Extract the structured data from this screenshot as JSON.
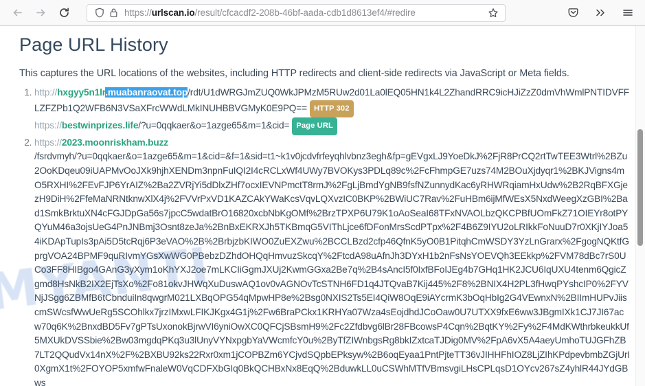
{
  "browser": {
    "back_label": "Back",
    "forward_label": "Forward",
    "reload_label": "Reload",
    "url_scheme": "https://",
    "url_host": "urlscan.io",
    "url_path": "/result/cfcacdf2-208b-46bf-aada-cdb1d8613ef4/#redire",
    "url_full": "https://urlscan.io/result/cfcacdf2-208b-46bf-aada-cdb1d8613ef4/#redire",
    "bookmark_label": "Bookmark this page",
    "pocket_label": "Save to Pocket",
    "overflow_label": "More tools",
    "menu_label": "Open application menu"
  },
  "page": {
    "title": "Page URL History",
    "intro": "This captures the URL locations of the websites, including HTTP redirects and client-side redirects via JavaScript or Meta fields.",
    "watermark": "MYANTI"
  },
  "items": [
    {
      "index": "1",
      "scheme": "http://",
      "host_plain": "hxgyy5n1lr",
      "host_selected": ".muabanraovat.top",
      "path": "/rdt/U1dWRGJmZUQ0WkJPMzM5RUw2d01La0lEQ05HN1k4L2ZhandRRC9icHJiZzZ0dmVhWmlPNTIDVFFLZFZPb1Q2WFB6N3VSaXFrcWWdLMkINUHBBVGMyK0E9PQ==",
      "badge": "HTTP 302",
      "badge_type": "http",
      "sub": {
        "scheme": "https://",
        "host": "bestwinprizes.life",
        "path": "/?u=0qqkaer&o=1azge65&m=1&cid=",
        "badge": "Page URL",
        "badge_type": "pageurl"
      }
    },
    {
      "index": "2",
      "scheme": "https://",
      "host_plain": "2023.moonriskham.buzz",
      "host_selected": "",
      "path": "/fsrdvmyh/?u=0qqkaer&o=1azge65&m=1&cid=&f=1&sid=t1~k1v0jcdvfrfeyqhlvbnz3egh&fp=gEVgxLJ9YoeDkJ%2FjR8PrCQ2rtTwTEE3Wtrl%2BZu2OoKDqeu09iUAPMvOoJXk9hjhXENDm3npnFuIQI2I4cRCLxWf4UWy7BVOKys3PDLq89c%2FcFhmpGE7uzs74M2BOuXjdyqr1%2BKJVigns4mO5RXHI%2FEvFJP6YrAIZ%2Ba2ZVRjYi5dDlxZHf7ocxIEVNPmctT8rmJ%2FgLjBmdYgNB9fsfNZunnydKac6yRHWRqiamHxUdw%2B2RqBFXGjezH9DiH%2FfeMaNRNtknwXlX4j%2FVVrPxVD1KAZCAkYWaKcsVqvLQXvzIC0BKP%2BWiUC7Rav%2FuHBm6ijMfWEsX5NxdWeegXzGBI%2Bad1SmkBrktuXN4cFGJDpGa56s7jpcC5wdatBrO16820xcbNbKgOMf%2BrzTPXP6U79K1oAoSeaI68TFxNVAOLbzQKCPBfUOmFkZ71OIEYr8otPYQYuM46a3ojsUeG4PnJNBmj3Osnt8zeJa%2BnBxEKRXJh5TKBmqG5VIThLjce6fDFonMrsScdPTpx%2F4B6Z9IYU2oLRIkkFoNuuD7r0XKjIYJoa54iKDApTupIs3pAi5D5tcRqj6P3eVAO%2B%2BrbjzbKIWO0ZuEXZwu%2BCCLBzd2cfp46QfnK5yO0B1PitqhCmWSDY3YzLnGrarx%2FgogNQKtfGprgVOA24BPMF9quRIvmYGsXwWG0PBebzDZhdOHQqHmvuzSkcqY%2FtcdA98uAfnJh3DYxH1b2nFsNsYOEVQh3EEkkp%2FVM78dBc7rS0UCo3FF8HIBgo4GAnG3yXym1oKhYXJ2oe7mLKCIiGgmJXUj2KwmGGxa2Be7q%2B4sAncI5f0IxfBFoIJEg4b7GHq1HK2JCU6IqUXU4tenm6QgicZgmd8HsNkB2IX2EjTsXo%2Fo81okvJHWqXuDuswAQ1ov0vAGNOvTcSTNH6FD1q4JTQvaB7Kij445%2F8%2BNIX4H2PL3fHwqPYshcIP0%2FYVNjJSgg6ZBMfB6tCbnduiIn8qwgrM021LXBqOPG54qMpwHP8e%2Bsg0NXIS2Ts5EI4QiW8OqE9iAYcrmK3bOqHbIg2G4VEwnxN%2BIImHUPvJiiscmSWcsfWwUeRg5SCOhlkx7jrzIMxwLFIKJKgx4G1j%2Fw6BraPCkx1KRHYa07Wza4sEojdhdJCoOaw0U7UTXX9fxE6ww3JBgmIXk1CJ7JI67acw70q6K%2BnxdBD5Fv7gPTsUxonokBjrwVI6yniOwXC0QFCjSBsmH9%2Fc2Zfdbvg6lBr28FBcowsP4Cqn%2BqtKY%2Fy%2F4MdKWthrbkeukkUf5MXUkDVSSbie%2Bw03mgdqPKq3u3lUnyVYNxpgbYaVWcmfcY0u%2ByTfZIWnbgsRg8bkIZxtcaTJDig0MV%2FpA6vX5A4aeyUmhoTUJGFhZB7LT2QQudVx14nX%2F%2BXBU92ks22Rxr0xm1jCOPBZm6YCjvdSQpbEPksyw%2B6oqEyaa1PntPjteTT36vJIHHFhIOZ8LjZIhKPdpevbmbZGjUrI0XgmX1t%2FOYOP5xmfwFnaleW0VqCDFXbGIq0BkQCHBxNx8EqQ%2BduwkLL0uCSWhMTfVBmsvgiLHsCPLqsD1OYcv267sZ4yhlR44JYdGBws"
    }
  ]
}
